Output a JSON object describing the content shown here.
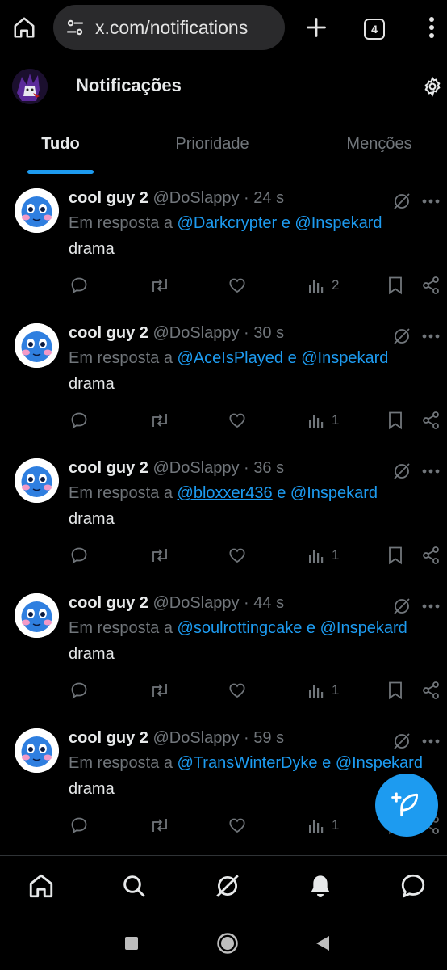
{
  "browser": {
    "url": "x.com/notifications",
    "tab_count": "4"
  },
  "header": {
    "title": "Notificações"
  },
  "tabs": [
    {
      "label": "Tudo",
      "active": true
    },
    {
      "label": "Prioridade",
      "active": false
    },
    {
      "label": "Menções",
      "active": false
    }
  ],
  "posts": [
    {
      "name": "cool guy 2",
      "meta": "@DoSlappy · 24 s",
      "reply_prefix": "Em resposta a",
      "mention1": "@Darkcrypter",
      "conj": "e",
      "mention2": "@Inspekard",
      "text": "drama",
      "views": "2"
    },
    {
      "name": "cool guy 2",
      "meta": "@DoSlappy · 30 s",
      "reply_prefix": "Em resposta a",
      "mention1": "@AceIsPlayed",
      "conj": "e",
      "mention2": "@Inspekard",
      "text": "drama",
      "views": "1"
    },
    {
      "name": "cool guy 2",
      "meta": "@DoSlappy · 36 s",
      "reply_prefix": "Em resposta a",
      "mention1": "@bloxxer436",
      "conj": "e",
      "mention2": "@Inspekard",
      "text": "drama",
      "views": "1"
    },
    {
      "name": "cool guy 2",
      "meta": "@DoSlappy · 44 s",
      "reply_prefix": "Em resposta a",
      "mention1": "@soulrottingcake",
      "conj": "e",
      "mention2": "@Inspekard",
      "text": "drama",
      "views": "1"
    },
    {
      "name": "cool guy 2",
      "meta": "@DoSlappy · 59 s",
      "reply_prefix": "Em resposta a",
      "mention1": "@TransWinterDyke",
      "conj": "e",
      "mention2": "@Inspekard",
      "text": "drama",
      "views": "1"
    }
  ],
  "colors": {
    "accent": "#1d9bf0",
    "text_primary": "#e7e9ea",
    "text_secondary": "#71767b",
    "background": "#000000",
    "divider": "#2f3336"
  },
  "icons": {
    "browser": [
      "home-icon",
      "site-settings-icon",
      "plus-icon",
      "tabs-icon",
      "more-vert-icon"
    ],
    "post_actions": [
      "reply-icon",
      "repost-icon",
      "like-icon",
      "views-icon",
      "bookmark-icon",
      "share-icon"
    ],
    "bottom_nav": [
      "home-icon",
      "search-icon",
      "grok-icon",
      "notifications-icon",
      "messages-icon"
    ],
    "system": [
      "recents-icon",
      "home-circle-icon",
      "back-icon"
    ]
  }
}
